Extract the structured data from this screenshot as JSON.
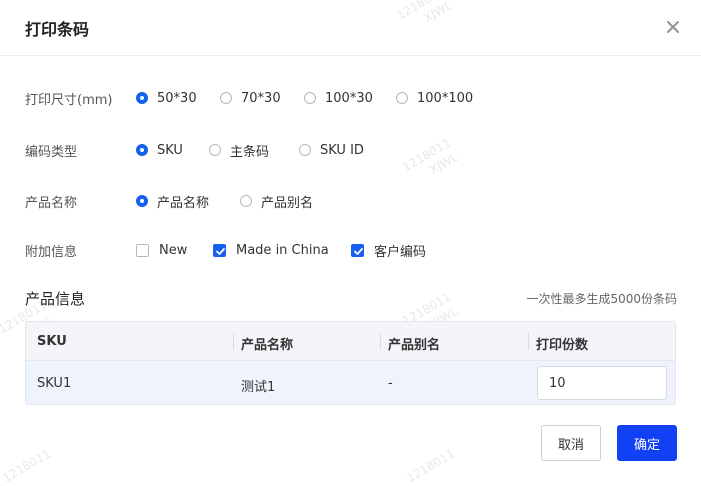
{
  "dialog": {
    "title": "打印条码",
    "close_icon": "close-icon"
  },
  "form": {
    "size": {
      "label": "打印尺寸(mm)",
      "options": [
        "50*30",
        "70*30",
        "100*30",
        "100*100"
      ],
      "selected": "50*30"
    },
    "code_type": {
      "label": "编码类型",
      "options": [
        "SKU",
        "主条码",
        "SKU ID"
      ],
      "selected": "SKU"
    },
    "product_name": {
      "label": "产品名称",
      "options": [
        "产品名称",
        "产品别名"
      ],
      "selected": "产品名称"
    },
    "extra_info": {
      "label": "附加信息",
      "options": [
        {
          "label": "New",
          "checked": false
        },
        {
          "label": "Made in China",
          "checked": true
        },
        {
          "label": "客户编码",
          "checked": true
        }
      ]
    }
  },
  "product_info": {
    "title": "产品信息",
    "note": "一次性最多生成5000份条码",
    "columns": [
      "SKU",
      "产品名称",
      "产品别名",
      "打印份数"
    ],
    "rows": [
      {
        "sku": "SKU1",
        "name": "测试1",
        "alias": "-",
        "copies": "10"
      }
    ]
  },
  "footer": {
    "cancel_label": "取消",
    "confirm_label": "确定"
  },
  "watermark": {
    "line1": "1218011",
    "line2": "XJWL"
  },
  "colors": {
    "accent": "#1560f0",
    "primary_button": "#1240f5",
    "row_highlight": "#eef3fc",
    "table_header": "#f3f5f9"
  }
}
